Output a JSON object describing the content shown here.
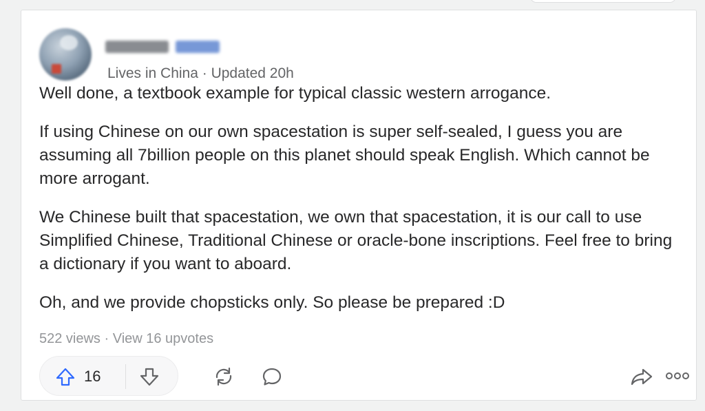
{
  "author": {
    "meta": "Lives in China · Updated 20h",
    "avatar_icon": "avatar-photo",
    "name_obscured": true
  },
  "answer": {
    "paragraphs": [
      "Well done, a textbook example for typical classic western arrogance.",
      "If using Chinese on our own spacestation is super self-sealed, I guess you are assuming all 7billion people on this planet should speak English. Which cannot be more arrogant.",
      "We Chinese built that spacestation, we own that spacestation, it is our call to use Simplified Chinese, Traditional Chinese or oracle-bone inscriptions. Feel free to bring a dictionary if you want to aboard.",
      "Oh, and we provide chopsticks only. So please be prepared :D"
    ]
  },
  "stats": {
    "text": "522 views · View 16 upvotes"
  },
  "actions": {
    "upvote_count": "16",
    "upvote_icon": "arrow-up-icon",
    "downvote_icon": "arrow-down-icon",
    "share_icon": "reshare-icon",
    "comment_icon": "comment-icon",
    "forward_icon": "share-arrow-icon",
    "more_icon": "more-icon"
  },
  "colors": {
    "text_primary": "#282829",
    "text_meta": "#636466",
    "text_muted": "#939598",
    "icon": "#2e69ff",
    "background": "#f1f2f2",
    "card": "#ffffff"
  }
}
